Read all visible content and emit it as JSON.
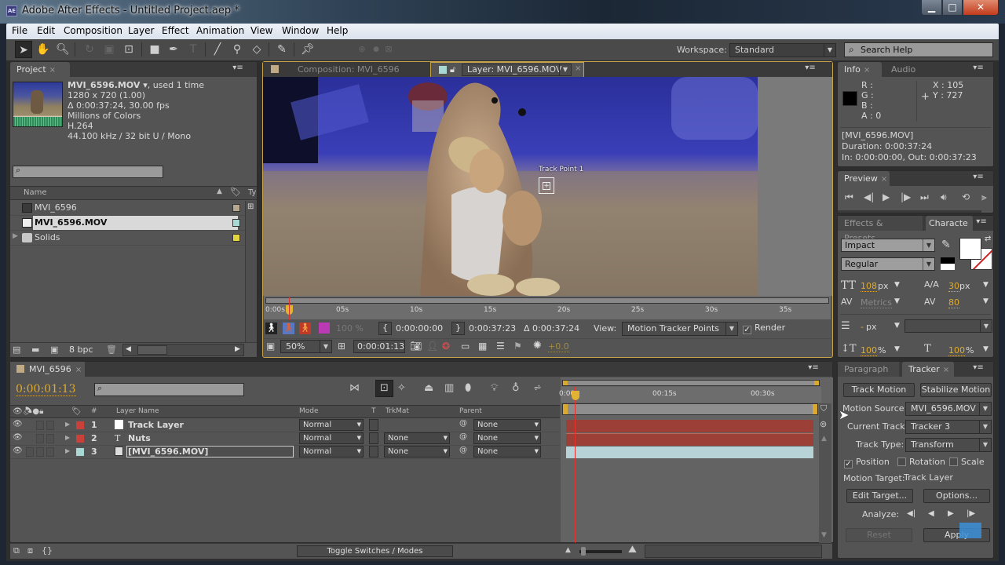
{
  "window": {
    "title": "Adobe After Effects - Untitled Project.aep *",
    "logo": "AE",
    "controls": {
      "minimize": "▁",
      "maximize": "□",
      "close": "✕"
    }
  },
  "menu": [
    "File",
    "Edit",
    "Composition",
    "Layer",
    "Effect",
    "Animation",
    "View",
    "Window",
    "Help"
  ],
  "toolbar": {
    "tools": [
      "selection-tool",
      "hand-tool",
      "zoom-tool",
      "rotation-tool",
      "camera-tool",
      "pan-behind-tool",
      "rectangle-tool",
      "pen-tool",
      "type-tool",
      "brush-tool",
      "clone-stamp-tool",
      "eraser-tool",
      "roto-brush-tool",
      "puppet-pin-tool"
    ],
    "workspace_label": "Workspace:",
    "workspace_value": "Standard",
    "search_placeholder": "Search Help"
  },
  "project": {
    "tab": "Project",
    "footage_name": "MVI_6596.MOV ▾",
    "used": ", used 1 time",
    "details": [
      "1280 x 720 (1.00)",
      "Δ 0:00:37:24, 30.00 fps",
      "Millions of Colors",
      "H.264",
      "44.100 kHz / 32 bit U / Mono"
    ],
    "column_name": "Name",
    "column_type": "Ty",
    "items": [
      {
        "name": "MVI_6596",
        "type": "composition",
        "label_color": "#b5a88e"
      },
      {
        "name": "MVI_6596.MOV",
        "type": "footage",
        "label_color": "#a9d8d4",
        "selected": true
      },
      {
        "name": "Solids",
        "type": "folder",
        "label_color": "#e3d33c"
      }
    ],
    "bpc": "8 bpc"
  },
  "viewer": {
    "comp_tab": "Composition: MVI_6596",
    "layer_tab": "Layer: MVI_6596.MOV",
    "track_point": "Track Point 1",
    "ruler_ticks": [
      "0:00s",
      "05s",
      "10s",
      "15s",
      "20s",
      "25s",
      "30s",
      "35s"
    ],
    "opacity": "100 %",
    "in_time": "0:00:00:00",
    "out_time": "0:00:37:23",
    "duration": "Δ 0:00:37:24",
    "view_label": "View:",
    "view_value": "Motion Tracker Points",
    "render_label": "Render",
    "render_checked": true,
    "zoom": "50%",
    "current_time": "0:00:01:13",
    "exposure": "+0.0"
  },
  "timeline": {
    "tab": "MVI_6596",
    "current_time": "0:00:01:13",
    "columns": {
      "num": "#",
      "layer_name": "Layer Name",
      "mode": "Mode",
      "t": "T",
      "trkmat": "TrkMat",
      "parent": "Parent"
    },
    "layers": [
      {
        "num": "1",
        "name": "Track Layer",
        "type": "solid",
        "label_color": "#c9413a",
        "mode": "Normal",
        "trkmat": "",
        "parent": "None"
      },
      {
        "num": "2",
        "name": "Nuts",
        "type": "text",
        "label_color": "#c9413a",
        "mode": "Normal",
        "trkmat": "None",
        "parent": "None"
      },
      {
        "num": "3",
        "name": "[MVI_6596.MOV]",
        "type": "footage",
        "label_color": "#a9d8d4",
        "mode": "Normal",
        "trkmat": "None",
        "parent": "None",
        "editing": true
      }
    ],
    "ruler_ticks": [
      "0:00s",
      "00:15s",
      "00:30s"
    ],
    "toggle_label": "Toggle Switches / Modes"
  },
  "info": {
    "tabs": [
      "Info",
      "Audio"
    ],
    "r": "R :",
    "g": "G :",
    "b": "B :",
    "a": "A : 0",
    "x": "X : 105",
    "y": "Y : 727",
    "source": "[MVI_6596.MOV]",
    "duration": "Duration: 0:00:37:24",
    "in_out": "In: 0:00:00:00, Out: 0:00:37:23"
  },
  "preview": {
    "tab": "Preview"
  },
  "character": {
    "tabs": [
      "Effects & Presets",
      "Characte"
    ],
    "font": "Impact",
    "style": "Regular",
    "size": "108",
    "leading": "30",
    "kerning": "Metrics",
    "tracking": "80",
    "stroke_width": "-",
    "vscale": "100",
    "hscale": "100",
    "unit_px": "px",
    "unit_pct": "%"
  },
  "tracker": {
    "tabs": [
      "Paragraph",
      "Tracker"
    ],
    "track_motion": "Track Motion",
    "stabilize_motion": "Stabilize Motion",
    "motion_source_label": "Motion Source:",
    "motion_source": "MVI_6596.MOV",
    "current_track_label": "Current Track:",
    "current_track": "Tracker 3",
    "track_type_label": "Track Type:",
    "track_type": "Transform",
    "position": "Position",
    "position_checked": true,
    "rotation": "Rotation",
    "rotation_checked": false,
    "scale": "Scale",
    "scale_checked": false,
    "motion_target_label": "Motion Target:",
    "motion_target": "Track Layer",
    "edit_target": "Edit Target...",
    "options": "Options...",
    "analyze_label": "Analyze:",
    "reset": "Reset",
    "apply": "Apply"
  }
}
